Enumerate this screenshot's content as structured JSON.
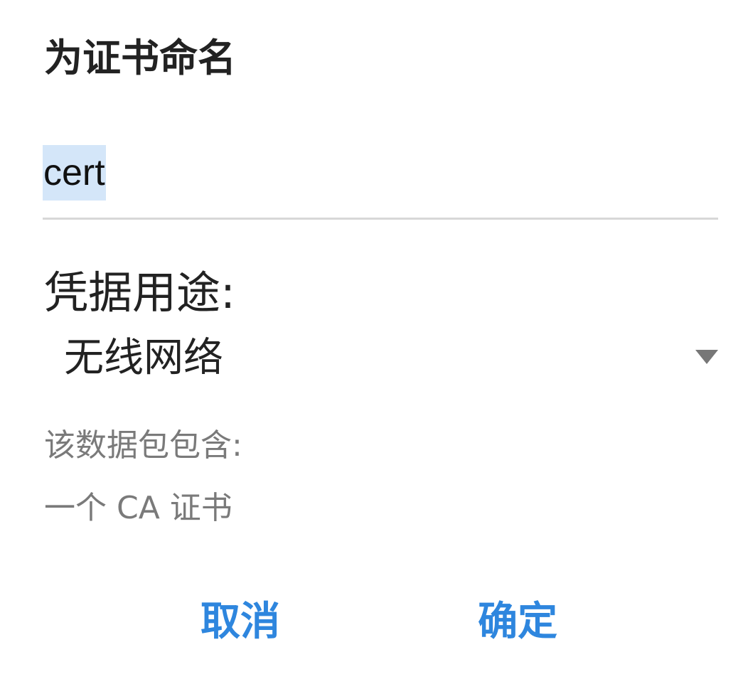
{
  "dialog": {
    "title": "为证书命名",
    "name_field": {
      "value": "cert",
      "selected": true
    },
    "usage": {
      "label": "凭据用途:",
      "selected_option": "无线网络"
    },
    "contents": {
      "label": "该数据包包含:",
      "items": [
        "一个 CA 证书"
      ]
    },
    "buttons": {
      "cancel": "取消",
      "ok": "确定"
    }
  },
  "colors": {
    "accent": "#2e86de",
    "selection_highlight": "#d4e6f9",
    "secondary_text": "#7a7a7a",
    "primary_text": "#222222"
  },
  "icons": {
    "dropdown": "triangle-down-icon"
  }
}
